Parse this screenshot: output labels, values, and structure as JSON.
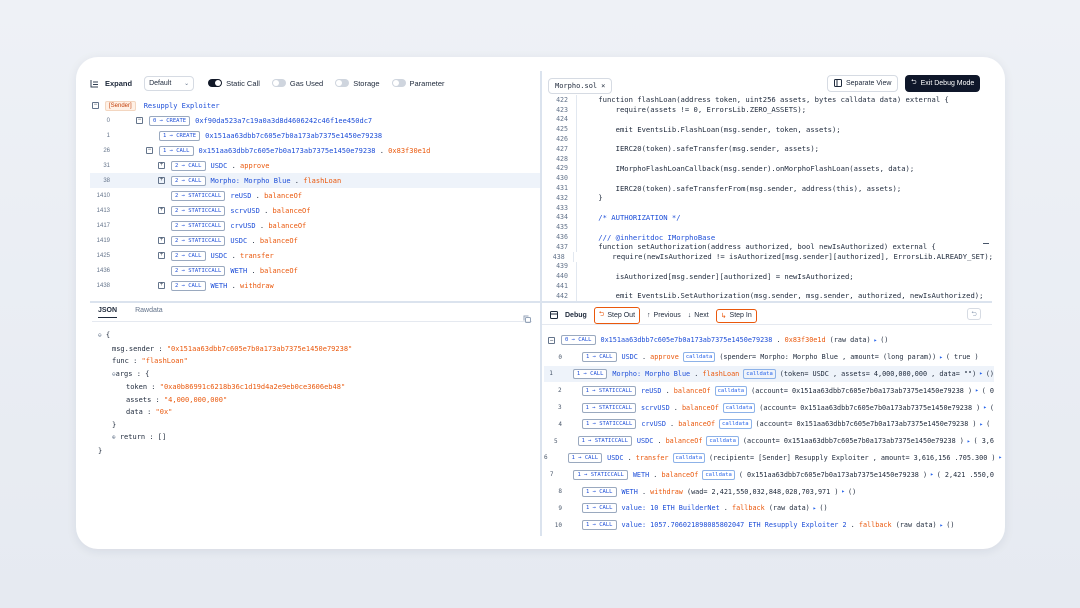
{
  "toolbar": {
    "expand": "Expand",
    "default": "Default",
    "static_call": "Static Call",
    "gas_used": "Gas Used",
    "storage": "Storage",
    "parameter": "Parameter"
  },
  "trace": {
    "root_sender": "[Sender]",
    "root_name": "Resupply Exploiter",
    "rows": [
      {
        "ln": "0",
        "badge": "0 → CREATE",
        "addr": "0xf90da523a7c19a0a3d8d4606242c46f1ee450dc7",
        "fn": ""
      },
      {
        "ln": "1",
        "badge": "1 → CREATE",
        "addr": "0x151aa63dbb7c605e7b0a173ab7375e1450e79238",
        "fn": ""
      },
      {
        "ln": "26",
        "badge": "1 → CALL",
        "addr": "0x151aa63dbb7c605e7b0a173ab7375e1450e79238",
        "fn": "0x83f30e1d"
      },
      {
        "ln": "31",
        "badge": "2 → CALL",
        "addr": "USDC",
        "fn": "approve"
      },
      {
        "ln": "38",
        "badge": "2 → CALL",
        "addr": "Morpho: Morpho Blue",
        "fn": "flashLoan"
      },
      {
        "ln": "1410",
        "badge": "2 → STATICCALL",
        "addr": "reUSD",
        "fn": "balanceOf"
      },
      {
        "ln": "1413",
        "badge": "2 → STATICCALL",
        "addr": "scrvUSD",
        "fn": "balanceOf"
      },
      {
        "ln": "1417",
        "badge": "2 → STATICCALL",
        "addr": "crvUSD",
        "fn": "balanceOf"
      },
      {
        "ln": "1419",
        "badge": "2 → STATICCALL",
        "addr": "USDC",
        "fn": "balanceOf"
      },
      {
        "ln": "1425",
        "badge": "2 → CALL",
        "addr": "USDC",
        "fn": "transfer"
      },
      {
        "ln": "1436",
        "badge": "2 → STATICCALL",
        "addr": "WETH",
        "fn": "balanceOf"
      },
      {
        "ln": "1438",
        "badge": "2 → CALL",
        "addr": "WETH",
        "fn": "withdraw"
      }
    ]
  },
  "editor": {
    "tab": "Morpho.sol",
    "separate_view": "Separate View",
    "exit_debug": "Exit Debug Mode",
    "lines": [
      {
        "n": "422",
        "t": "    function flashLoan(address token, uint256 assets, bytes calldata data) external {"
      },
      {
        "n": "423",
        "t": "        require(assets != 0, ErrorsLib.ZERO_ASSETS);"
      },
      {
        "n": "424",
        "t": ""
      },
      {
        "n": "425",
        "t": "        emit EventsLib.FlashLoan(msg.sender, token, assets);"
      },
      {
        "n": "426",
        "t": ""
      },
      {
        "n": "427",
        "t": "        IERC20(token).safeTransfer(msg.sender, assets);"
      },
      {
        "n": "428",
        "t": ""
      },
      {
        "n": "429",
        "t": "        IMorphoFlashLoanCallback(msg.sender).onMorphoFlashLoan(assets, data);"
      },
      {
        "n": "430",
        "t": ""
      },
      {
        "n": "431",
        "t": "        IERC20(token).safeTransferFrom(msg.sender, address(this), assets);"
      },
      {
        "n": "432",
        "t": "    }"
      },
      {
        "n": "433",
        "t": ""
      },
      {
        "n": "434",
        "t": "    /* AUTHORIZATION */"
      },
      {
        "n": "435",
        "t": ""
      },
      {
        "n": "436",
        "t": "    /// @inheritdoc IMorphoBase"
      },
      {
        "n": "437",
        "t": "    function setAuthorization(address authorized, bool newIsAuthorized) external {"
      },
      {
        "n": "438",
        "t": "        require(newIsAuthorized != isAuthorized[msg.sender][authorized], ErrorsLib.ALREADY_SET);"
      },
      {
        "n": "439",
        "t": ""
      },
      {
        "n": "440",
        "t": "        isAuthorized[msg.sender][authorized] = newIsAuthorized;"
      },
      {
        "n": "441",
        "t": ""
      },
      {
        "n": "442",
        "t": "        emit EventsLib.SetAuthorization(msg.sender, msg.sender, authorized, newIsAuthorized);"
      }
    ]
  },
  "json_panel": {
    "tab_json": "JSON",
    "tab_raw": "Rawdata",
    "msg_sender_key": "msg.sender",
    "msg_sender": "\"0x151aa63dbb7c605e7b0a173ab7375e1450e79238\"",
    "func_key": "func",
    "func": "\"flashLoan\"",
    "args_key": "args",
    "token_key": "token",
    "token": "\"0xa0b86991c6218b36c1d19d4a2e9eb0ce3606eb48\"",
    "assets_key": "assets",
    "assets": "\"4,000,000,000\"",
    "data_key": "data",
    "data": "\"0x\"",
    "return_key": "return",
    "return_val": "[]"
  },
  "debug": {
    "title": "Debug",
    "step_out": "Step Out",
    "previous": "Previous",
    "next": "Next",
    "step_in": "Step In",
    "head": {
      "badge": "0 → CALL",
      "addr": "0x151aa63dbb7c605e7b0a173ab7375e1450e79238",
      "fn": "0x83f30e1d",
      "rest": "(raw data)",
      "ret": "()"
    },
    "rows": [
      {
        "ln": "0",
        "badge": "1 → CALL",
        "addr": "USDC",
        "fn": "approve",
        "args": "(spender= Morpho: Morpho Blue , amount= (long param))",
        "ret": "( true )"
      },
      {
        "ln": "1",
        "badge": "1 → CALL",
        "addr": "Morpho: Morpho Blue",
        "fn": "flashLoan",
        "args": "(token= USDC , assets= 4,000,000,000 , data= \"\")",
        "ret": "()"
      },
      {
        "ln": "2",
        "badge": "1 → STATICCALL",
        "addr": "reUSD",
        "fn": "balanceOf",
        "args": "(account= 0x151aa63dbb7c605e7b0a173ab7375e1450e79238 )",
        "ret": "( 0"
      },
      {
        "ln": "3",
        "badge": "1 → STATICCALL",
        "addr": "scrvUSD",
        "fn": "balanceOf",
        "args": "(account= 0x151aa63dbb7c605e7b0a173ab7375e1450e79238 )",
        "ret": "("
      },
      {
        "ln": "4",
        "badge": "1 → STATICCALL",
        "addr": "crvUSD",
        "fn": "balanceOf",
        "args": "(account= 0x151aa63dbb7c605e7b0a173ab7375e1450e79238 )",
        "ret": "("
      },
      {
        "ln": "5",
        "badge": "1 → STATICCALL",
        "addr": "USDC",
        "fn": "balanceOf",
        "args": "(account= 0x151aa63dbb7c605e7b0a173ab7375e1450e79238 )",
        "ret": "( 3,6"
      },
      {
        "ln": "6",
        "badge": "1 → CALL",
        "addr": "USDC",
        "fn": "transfer",
        "args": "(recipient= [Sender] Resupply Exploiter , amount= 3,616,156 .705.300 )",
        "ret": "( true"
      },
      {
        "ln": "7",
        "badge": "1 → STATICCALL",
        "addr": "WETH",
        "fn": "balanceOf",
        "args": "( 0x151aa63dbb7c605e7b0a173ab7375e1450e79238 )",
        "ret": "( 2,421 .550,0"
      },
      {
        "ln": "8",
        "badge": "1 → CALL",
        "addr": "WETH",
        "fn": "withdraw",
        "args": "(wad= 2,421,550,032,848,028,703,971 )",
        "ret": "()"
      },
      {
        "ln": "9",
        "badge": "1 → CALL",
        "addr": "value: 10 ETH  BuilderNet",
        "fn": "fallback",
        "args": "(raw data)",
        "ret": "()"
      },
      {
        "ln": "10",
        "badge": "1 → CALL",
        "addr": "value: 1057.706021898085802047 ETH  Resupply Exploiter 2",
        "fn": "fallback",
        "args": "(raw data)",
        "ret": "()"
      }
    ]
  }
}
